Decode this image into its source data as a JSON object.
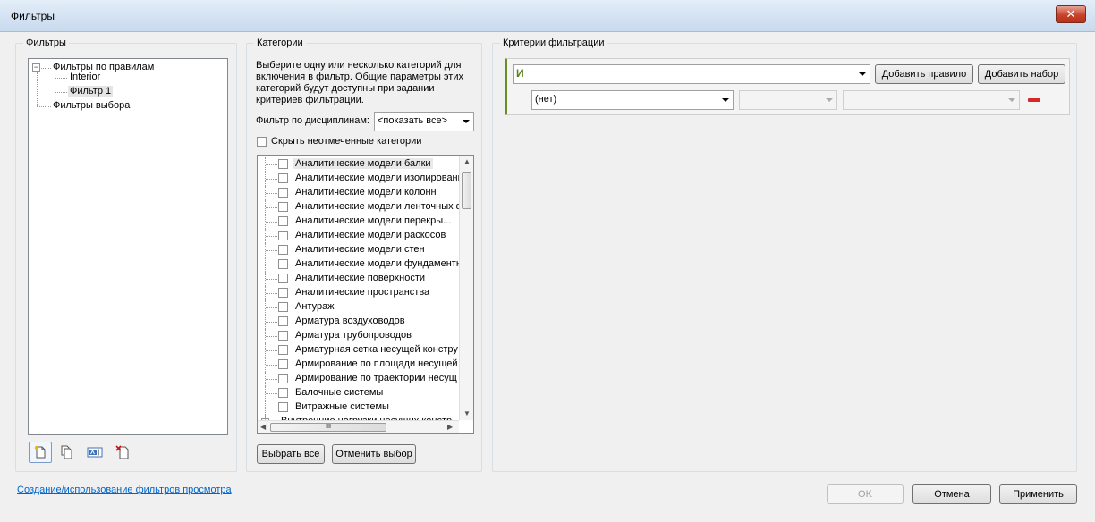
{
  "window": {
    "title": "Фильтры",
    "close_label": "✕"
  },
  "filters_panel": {
    "title": "Фильтры",
    "tree": {
      "rules_group": "Фильтры по правилам",
      "rules_children": [
        "Interior",
        "Фильтр 1"
      ],
      "selection_group": "Фильтры выбора",
      "expander_symbol": "−"
    },
    "toolbar_icons": [
      "new-filter-icon",
      "duplicate-filter-icon",
      "rename-filter-icon",
      "delete-filter-icon"
    ]
  },
  "categories_panel": {
    "title": "Категории",
    "description": "Выберите одну или несколько категорий для включения в фильтр. Общие параметры этих категорий будут доступны при задании критериев фильтрации.",
    "discipline_label": "Фильтр по дисциплинам:",
    "discipline_value": "<показать все>",
    "hide_unchecked_label": "Скрыть неотмеченные категории",
    "items": [
      "Аналитические модели балки",
      "Аналитические модели изолированн",
      "Аналитические модели колонн",
      "Аналитические модели ленточных ф",
      "Аналитические модели перекры...",
      "Аналитические модели раскосов",
      "Аналитические модели стен",
      "Аналитические модели фундаментн",
      "Аналитические поверхности",
      "Аналитические пространства",
      "Антураж",
      "Арматура воздуховодов",
      "Арматура трубопроводов",
      "Арматурная сетка несущей констру",
      "Армирование по площади несущей",
      "Армирование по траектории несущ",
      "Балочные системы",
      "Витражные системы",
      "Внутренние нагрузки несущих констр"
    ],
    "expander_symbol": "+",
    "hscroll_grip": "III",
    "select_all_label": "Выбрать все",
    "clear_selection_label": "Отменить выбор"
  },
  "criteria_panel": {
    "title": "Критерии фильтрации",
    "operator_value": "И",
    "add_rule_label": "Добавить правило",
    "add_set_label": "Добавить набор",
    "rule_param_value": "(нет)",
    "rule_operator_value": "",
    "rule_value": "",
    "accent_color": "#6b8e23"
  },
  "footer": {
    "help_link": "Создание/использование фильтров просмотра",
    "ok_label": "OK",
    "cancel_label": "Отмена",
    "apply_label": "Применить"
  }
}
